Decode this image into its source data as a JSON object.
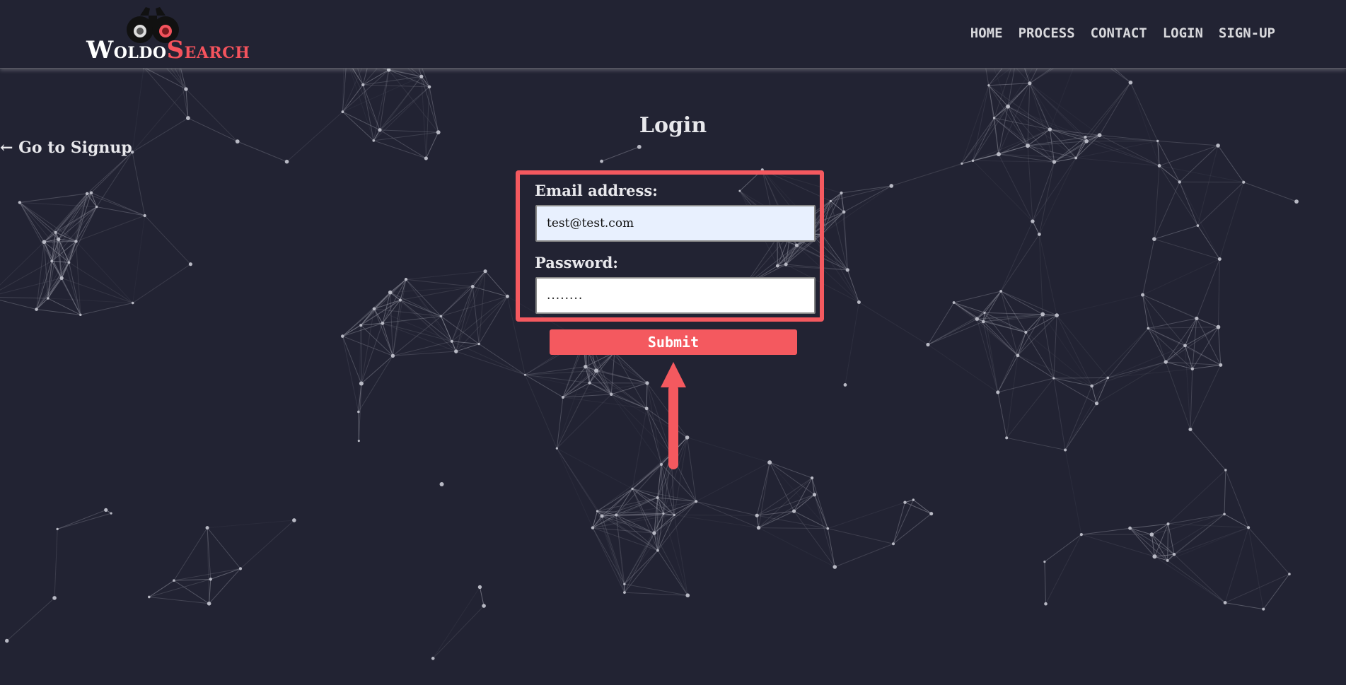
{
  "header": {
    "logo": {
      "part1_big": "W",
      "part1_rest": "OLDO",
      "part2_big": "S",
      "part2_rest": "EARCH"
    },
    "nav": [
      {
        "label": "HOME"
      },
      {
        "label": "PROCESS"
      },
      {
        "label": "CONTACT"
      },
      {
        "label": "LOGIN"
      },
      {
        "label": "SIGN-UP"
      }
    ]
  },
  "back_link": {
    "label": "← Go to Signup"
  },
  "page_title": "Login",
  "form": {
    "email": {
      "label": "Email address:",
      "value": "test@test.com"
    },
    "password": {
      "label": "Password:",
      "value": "........"
    },
    "submit_label": "Submit"
  },
  "colors": {
    "background": "#222333",
    "accent": "#f4595f",
    "text": "#e8e8ec",
    "network_lines": "#8a8b98"
  }
}
